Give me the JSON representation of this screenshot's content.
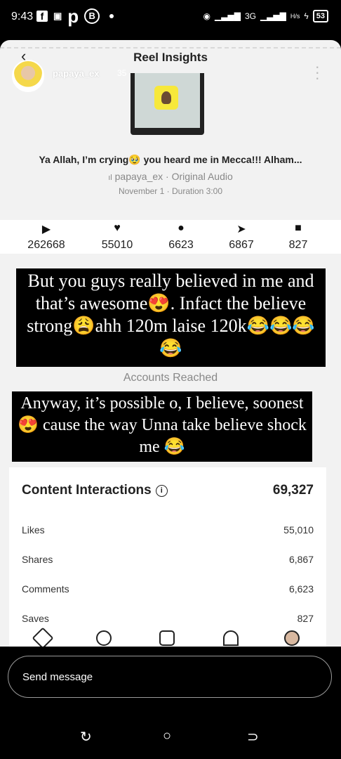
{
  "status_bar": {
    "time": "9:43",
    "network": "3G",
    "data_rate": "H/s",
    "battery": "53"
  },
  "header": {
    "title": "Reel Insights",
    "username": "papaya_ex",
    "story_time": "35"
  },
  "reel": {
    "caption": "Ya Allah, I’m crying🥹 you heard me in Mecca!!! Alham...",
    "audio": "papaya_ex · Original Audio",
    "meta": "November 1 · Duration 3:00"
  },
  "stats": [
    {
      "icon": "play-icon",
      "value": "262668"
    },
    {
      "icon": "heart-icon",
      "value": "55010"
    },
    {
      "icon": "comment-icon",
      "value": "6623"
    },
    {
      "icon": "send-icon",
      "value": "6867"
    },
    {
      "icon": "bookmark-icon",
      "value": "827"
    }
  ],
  "overlay_text_1": "But you guys really believed in me and that’s awesome😍. Infact the believe strong😩ahh 120m laise 120k😂😂😂😂",
  "section_label": "Accounts Reached",
  "overlay_text_2": "Anyway, it’s possible o, I believe, soonest😍 cause the way Unna take believe shock me 😂",
  "content_interactions": {
    "title": "Content Interactions",
    "total": "69,327",
    "rows": [
      {
        "label": "Likes",
        "value": "55,010"
      },
      {
        "label": "Shares",
        "value": "6,867"
      },
      {
        "label": "Comments",
        "value": "6,623"
      },
      {
        "label": "Saves",
        "value": "827"
      }
    ]
  },
  "reply": {
    "placeholder": "Send message"
  }
}
